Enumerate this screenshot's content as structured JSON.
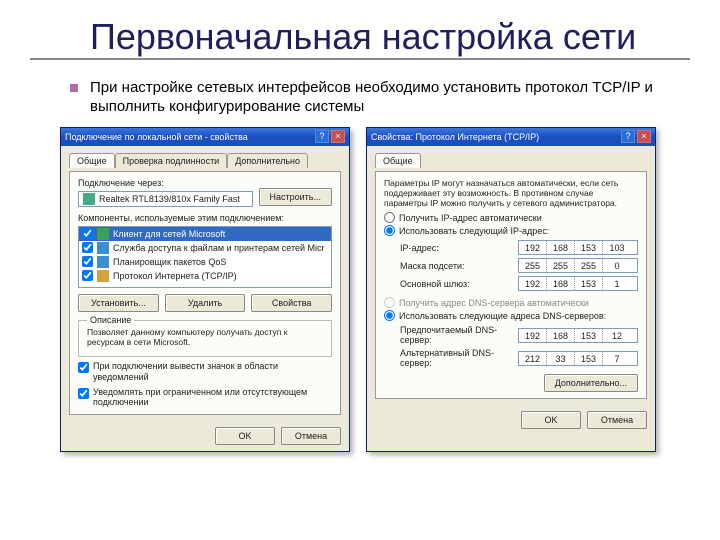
{
  "slide": {
    "title": "Первоначальная настройка сети",
    "bullet": "При настройке сетевых интерфейсов необходимо установить протокол TCP/IP и выполнить конфигурирование системы"
  },
  "win1": {
    "title": "Подключение по локальной сети - свойства",
    "tabs": {
      "t1": "Общие",
      "t2": "Проверка подлинности",
      "t3": "Дополнительно"
    },
    "connect_label": "Подключение через:",
    "adapter": "Realtek RTL8139/810x Family Fast",
    "configure_btn": "Настроить...",
    "components_label": "Компоненты, используемые этим подключением:",
    "items": {
      "i1": "Клиент для сетей Microsoft",
      "i2": "Служба доступа к файлам и принтерам сетей Micr",
      "i3": "Планировщик пакетов QoS",
      "i4": "Протокол Интернета (TCP/IP)"
    },
    "btns": {
      "install": "Установить...",
      "remove": "Удалить",
      "props": "Свойства"
    },
    "desc_caption": "Описание",
    "desc_text": "Позволяет данному компьютеру получать доступ к ресурсам в сети Microsoft.",
    "chk1": "При подключении вывести значок в области уведомлений",
    "chk2": "Уведомлять при ограниченном или отсутствующем подключении",
    "ok": "OK",
    "cancel": "Отмена"
  },
  "win2": {
    "title": "Свойства: Протокол Интернета (TCP/IP)",
    "tab": "Общие",
    "note": "Параметры IP могут назначаться автоматически, если сеть поддерживает эту возможность. В противном случае параметры IP можно получить у сетевого администратора.",
    "r_auto_ip": "Получить IP-адрес автоматически",
    "r_manual_ip": "Использовать следующий IP-адрес:",
    "ip_label": "IP-адрес:",
    "mask_label": "Маска подсети:",
    "gw_label": "Основной шлюз:",
    "r_auto_dns": "Получить адрес DNS-сервера автоматически",
    "r_manual_dns": "Использовать следующие адреса DNS-серверов:",
    "dns1_label": "Предпочитаемый DNS-сервер:",
    "dns2_label": "Альтернативный DNS-сервер:",
    "adv_btn": "Дополнительно...",
    "ok": "OK",
    "cancel": "Отмена",
    "ip": {
      "a": "192",
      "b": "168",
      "c": "153",
      "d": "103"
    },
    "mask": {
      "a": "255",
      "b": "255",
      "c": "255",
      "d": "0"
    },
    "gw": {
      "a": "192",
      "b": "168",
      "c": "153",
      "d": "1"
    },
    "dns1": {
      "a": "192",
      "b": "168",
      "c": "153",
      "d": "12"
    },
    "dns2": {
      "a": "212",
      "b": "33",
      "c": "153",
      "d": "7"
    }
  }
}
